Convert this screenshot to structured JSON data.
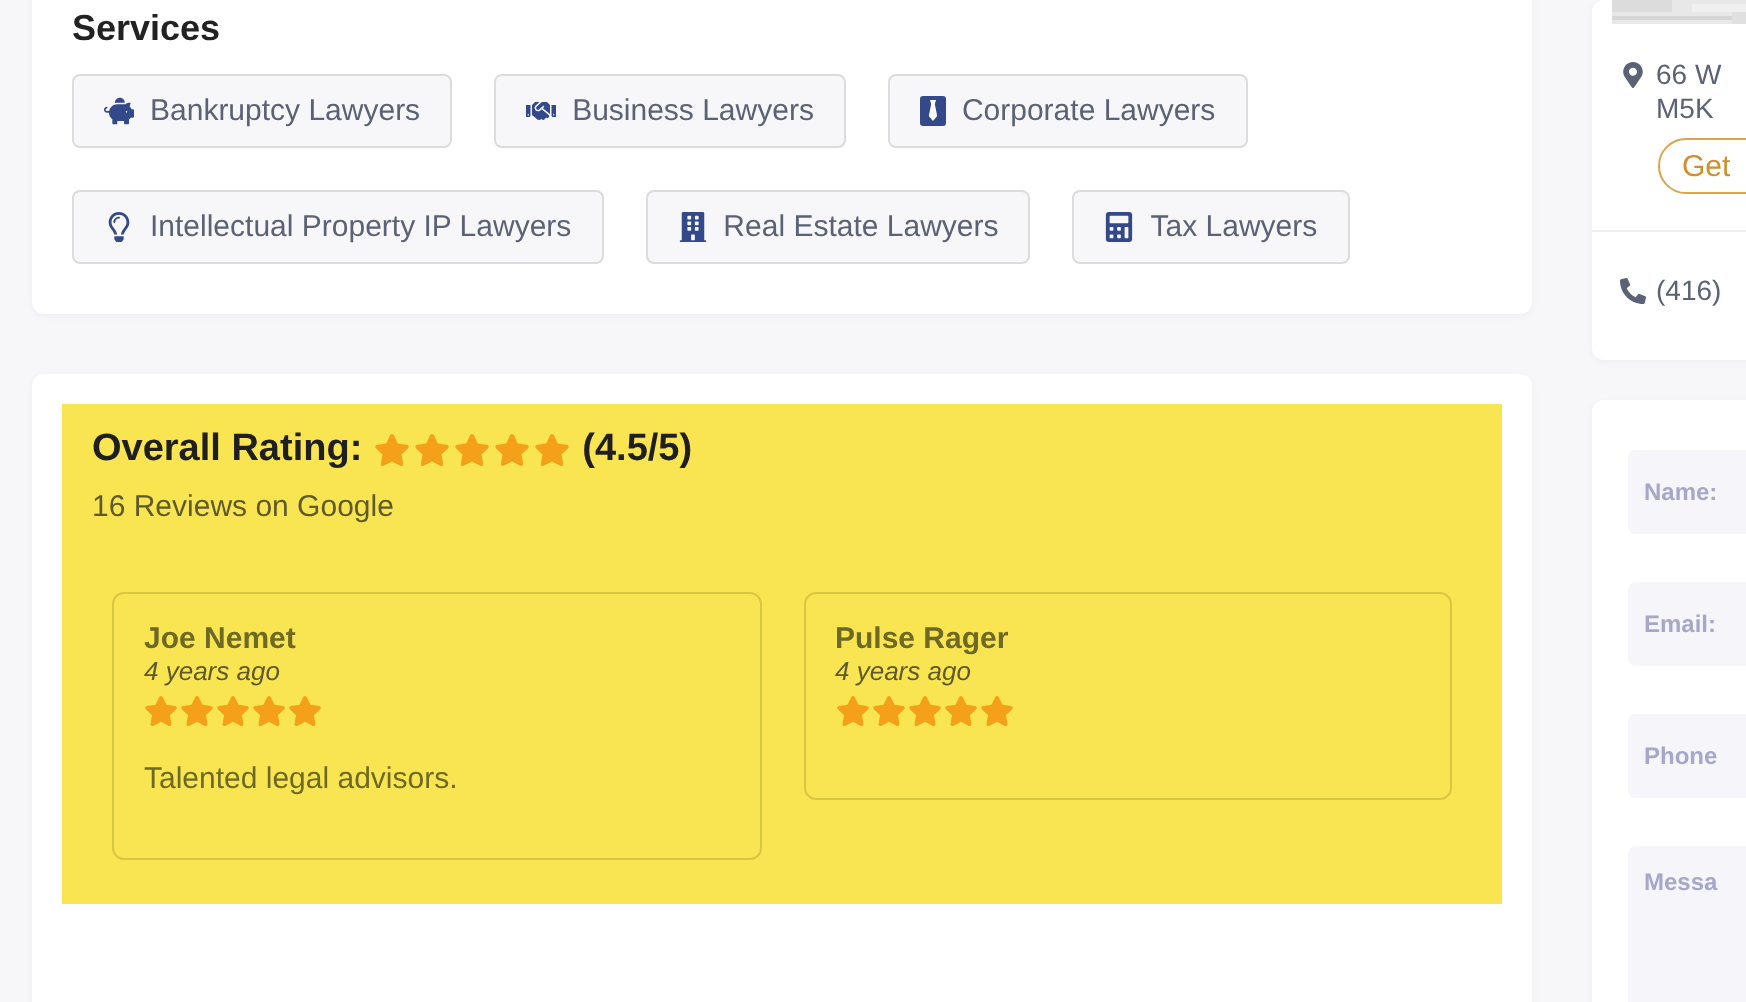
{
  "services": {
    "title": "Services",
    "items": [
      {
        "label": "Bankruptcy Lawyers",
        "kind": "piggy"
      },
      {
        "label": "Business Lawyers",
        "kind": "handshake"
      },
      {
        "label": "Corporate Lawyers",
        "kind": "tie"
      },
      {
        "label": "Intellectual Property IP Lawyers",
        "kind": "bulb"
      },
      {
        "label": "Real Estate Lawyers",
        "kind": "building"
      },
      {
        "label": "Tax Lawyers",
        "kind": "calculator"
      }
    ]
  },
  "rating": {
    "label": "Overall Rating:",
    "stars": 5,
    "score": "(4.5/5)",
    "summary": "16 Reviews on Google",
    "reviews": [
      {
        "name": "Joe Nemet",
        "time": "4 years ago",
        "stars": 5,
        "text": "Talented legal advisors."
      },
      {
        "name": "Pulse Rager",
        "time": "4 years ago",
        "stars": 5
      }
    ]
  },
  "contact": {
    "address_lines": [
      "66 W",
      "M5K"
    ],
    "directions_button": "Get",
    "phone": "(416)"
  },
  "form": {
    "fields": [
      {
        "placeholder": "Name:",
        "kind": "input"
      },
      {
        "placeholder": "Email:",
        "kind": "input"
      },
      {
        "placeholder": "Phone",
        "kind": "input"
      },
      {
        "placeholder": "Messa",
        "kind": "textarea"
      }
    ]
  }
}
